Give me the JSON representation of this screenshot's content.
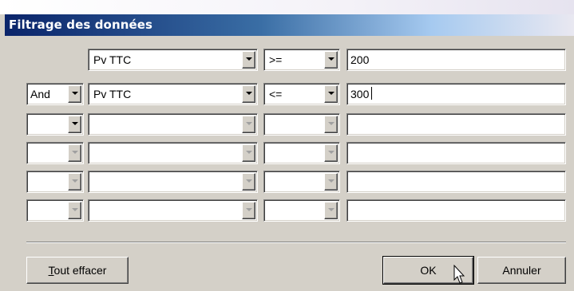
{
  "window": {
    "title": "Filtrage des données"
  },
  "filter_rows": [
    {
      "logic": "",
      "field": "Pv TTC",
      "operator": ">=",
      "value": "200"
    },
    {
      "logic": "And",
      "field": "Pv TTC",
      "operator": "<=",
      "value": "300"
    },
    {
      "logic": "",
      "field": "",
      "operator": "",
      "value": ""
    },
    {
      "logic": "",
      "field": "",
      "operator": "",
      "value": ""
    },
    {
      "logic": "",
      "field": "",
      "operator": "",
      "value": ""
    },
    {
      "logic": "",
      "field": "",
      "operator": "",
      "value": ""
    }
  ],
  "buttons": {
    "clear_prefix": "T",
    "clear_rest": "out effacer",
    "ok": "OK",
    "cancel": "Annuler"
  },
  "icons": {
    "dropdown": "chevron-down-icon",
    "cursor": "mouse-pointer-icon"
  },
  "colors": {
    "title_start": "#0a246a",
    "title_end": "#a6caf0",
    "face": "#d4d0c8"
  }
}
